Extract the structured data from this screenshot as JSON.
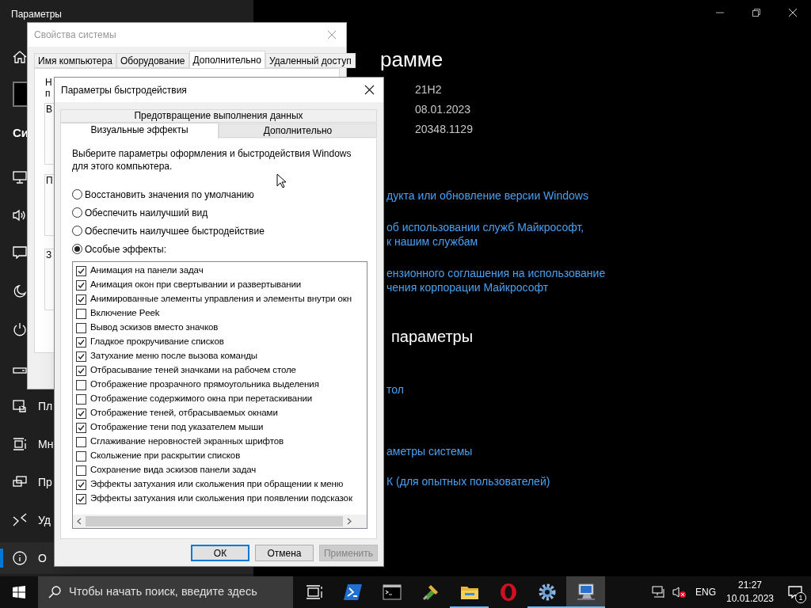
{
  "settings": {
    "title": "Параметры",
    "section_heading": "Си",
    "nav": [
      {
        "selected": false
      },
      {
        "selected": false
      },
      {
        "selected": false
      },
      {
        "selected": false
      },
      {
        "selected": false
      },
      {
        "selected": false
      },
      {
        "label": "Пл",
        "selected": false
      },
      {
        "label": "Мн",
        "selected": false
      },
      {
        "label": "Пр",
        "selected": false
      },
      {
        "label": "Уд",
        "selected": false
      },
      {
        "label": "О",
        "selected": true
      }
    ],
    "page_heading": "рамме",
    "values": [
      "21H2",
      "08.01.2023",
      "20348.1129"
    ],
    "links_top": [
      [
        "дукта или обновление версии Windows"
      ],
      [
        "об использовании служб Майкрософт,",
        "к нашим службам"
      ],
      [
        "ензионного соглашения на использование",
        "чения корпорации Майкрософт"
      ]
    ],
    "section2_heading": "параметры",
    "links_bottom": [
      "тол",
      "аметры системы",
      "К (для опытных пользователей)"
    ]
  },
  "system_properties": {
    "title": "Свойства системы",
    "tabs": [
      {
        "label": "Имя компьютера",
        "selected": false
      },
      {
        "label": "Оборудование",
        "selected": false
      },
      {
        "label": "Дополнительно",
        "selected": true
      },
      {
        "label": "Удаленный доступ",
        "selected": false
      }
    ],
    "fragments": [
      "Н",
      "п"
    ],
    "groups": [
      "В",
      "П",
      "З"
    ]
  },
  "performance": {
    "title": "Параметры быстродействия",
    "tabs_back": [
      {
        "label": "Предотвращение выполнения данных",
        "selected": false
      }
    ],
    "tabs_front": [
      {
        "label": "Визуальные эффекты",
        "selected": true
      },
      {
        "label": "Дополнительно",
        "selected": false
      }
    ],
    "description": "Выберите параметры оформления и быстродействия Windows для этого компьютера.",
    "options": [
      {
        "label": "Восстановить значения по умолчанию",
        "selected": false
      },
      {
        "label": "Обеспечить наилучший вид",
        "selected": false
      },
      {
        "label": "Обеспечить наилучшее быстродействие",
        "selected": false
      },
      {
        "label": "Особые эффекты:",
        "selected": true
      }
    ],
    "effects": [
      {
        "label": "Анимация на панели задач",
        "checked": true
      },
      {
        "label": "Анимация окон при свертывании и развертывании",
        "checked": true
      },
      {
        "label": "Анимированные элементы управления и элементы внутри окн",
        "checked": true
      },
      {
        "label": "Включение Peek",
        "checked": false
      },
      {
        "label": "Вывод эскизов вместо значков",
        "checked": false
      },
      {
        "label": "Гладкое прокручивание списков",
        "checked": true
      },
      {
        "label": "Затухание меню после вызова команды",
        "checked": true
      },
      {
        "label": "Отбрасывание теней значками на рабочем столе",
        "checked": true
      },
      {
        "label": "Отображение прозрачного прямоугольника выделения",
        "checked": false
      },
      {
        "label": "Отображение содержимого окна при перетаскивании",
        "checked": false
      },
      {
        "label": "Отображение теней, отбрасываемых окнами",
        "checked": true
      },
      {
        "label": "Отображение тени под указателем мыши",
        "checked": true
      },
      {
        "label": "Сглаживание неровностей экранных шрифтов",
        "checked": false
      },
      {
        "label": "Скольжение при раскрытии списков",
        "checked": false
      },
      {
        "label": "Сохранение вида эскизов панели задач",
        "checked": false
      },
      {
        "label": "Эффекты затухания или скольжения при обращении к меню",
        "checked": true
      },
      {
        "label": "Эффекты затухания или скольжения при появлении подсказок",
        "checked": true
      }
    ],
    "buttons": [
      {
        "label": "ОК",
        "default": true,
        "disabled": false
      },
      {
        "label": "Отмена",
        "default": false,
        "disabled": false
      },
      {
        "label": "Применить",
        "default": false,
        "disabled": true
      }
    ]
  },
  "taskbar": {
    "search_placeholder": "Чтобы начать поиск, введите здесь",
    "apps": [
      {
        "running": false,
        "selected": false
      },
      {
        "running": false,
        "selected": false
      },
      {
        "running": false,
        "selected": false
      },
      {
        "running": false,
        "selected": false
      },
      {
        "running": true,
        "selected": false
      },
      {
        "running": false,
        "selected": false
      },
      {
        "running": true,
        "selected": false
      },
      {
        "running": true,
        "selected": true
      }
    ],
    "language": "ENG",
    "time": "21:27",
    "date": "10.01.2023",
    "notification_count": "1"
  }
}
